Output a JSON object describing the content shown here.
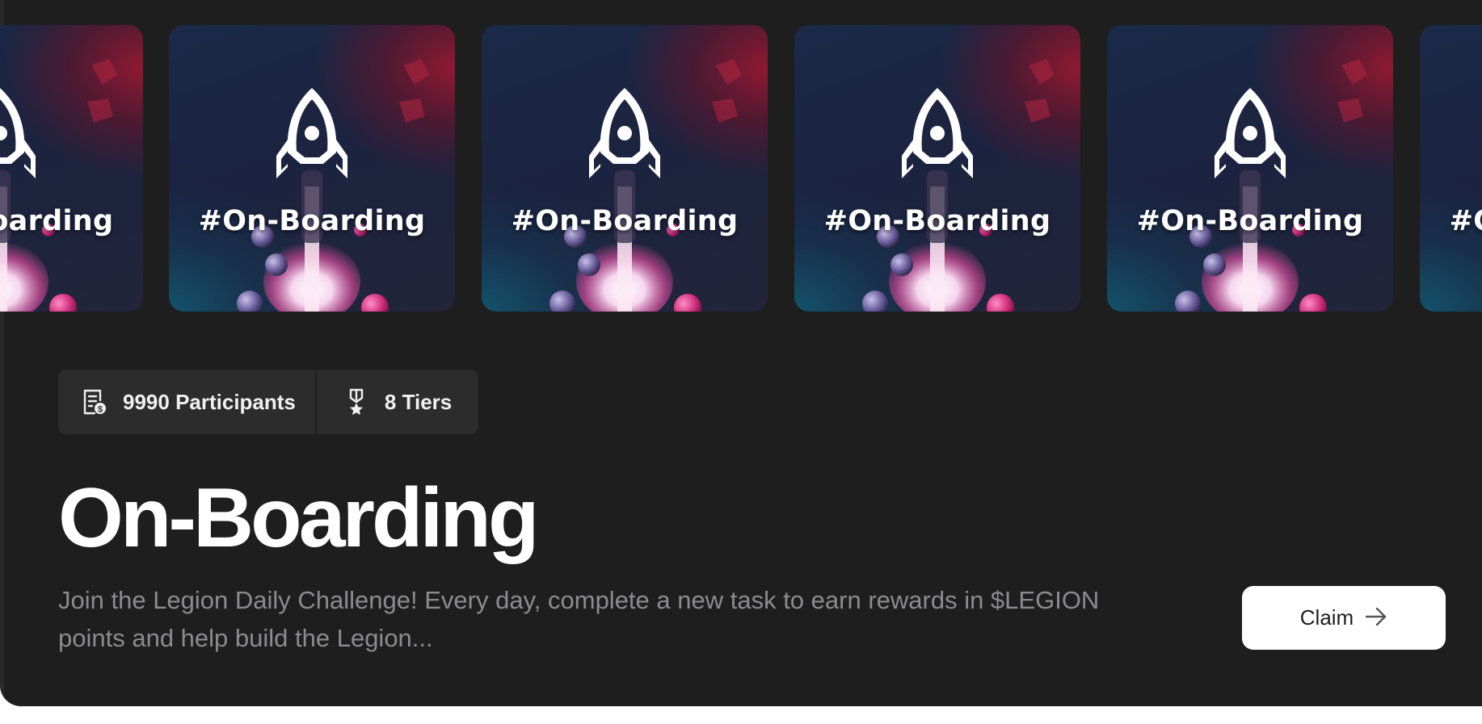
{
  "carousel": {
    "cards": [
      {
        "label": "#On-Boarding"
      },
      {
        "label": "#On-Boarding"
      },
      {
        "label": "#On-Boarding"
      },
      {
        "label": "#On-Boarding"
      },
      {
        "label": "#On-Boarding"
      },
      {
        "label": "#On-Boarding"
      }
    ],
    "icon": "rocket-icon"
  },
  "stats": {
    "participants_icon": "clipboard-badge-icon",
    "participants": "9990 Participants",
    "tiers_icon": "medal-icon",
    "tiers": "8 Tiers"
  },
  "challenge": {
    "title": "On-Boarding",
    "description": "Join the Legion Daily Challenge! Every day, complete a new task to earn rewards in $LEGION points and help build the Legion..."
  },
  "actions": {
    "claim_label": "Claim",
    "claim_icon": "arrow-right-icon"
  },
  "colors": {
    "panel": "#1e1e1f",
    "chip": "#2c2c2d",
    "button": "#ffffff",
    "muted_text": "#8c8c8e"
  }
}
